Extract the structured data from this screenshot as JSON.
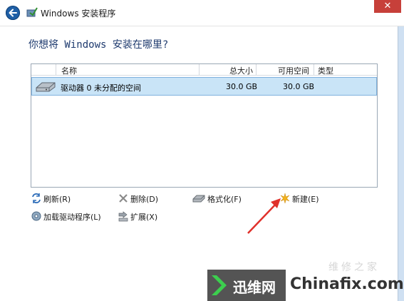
{
  "window": {
    "title": "Windows 安装程序",
    "close_label": "✕"
  },
  "page": {
    "heading": "你想将 Windows 安装在哪里?"
  },
  "disk_list": {
    "columns": [
      "名称",
      "总大小",
      "可用空间",
      "类型"
    ],
    "rows": [
      {
        "name": "驱动器 0 未分配的空间",
        "total": "30.0 GB",
        "free": "30.0 GB",
        "type": ""
      }
    ]
  },
  "actions": {
    "refresh": "刷新(R)",
    "delete": "删除(D)",
    "format": "格式化(F)",
    "new": "新建(E)",
    "load_driver": "加载驱动程序(L)",
    "extend": "扩展(X)"
  },
  "watermark": {
    "cn": "迅维网",
    "en": "Chinafix.com",
    "faint": "维修之家"
  },
  "colors": {
    "accent": "#1f5fa6",
    "selected_row": "#c9e4f7",
    "close": "#c7403a",
    "arrow": "#e0312b"
  },
  "icons": {
    "back": "back-arrow-icon",
    "app": "setup-icon",
    "disk": "hard-disk-icon",
    "refresh": "refresh-icon",
    "delete": "delete-x-icon",
    "format": "format-disk-icon",
    "new": "new-star-icon",
    "load_driver": "load-driver-icon",
    "extend": "extend-icon"
  }
}
